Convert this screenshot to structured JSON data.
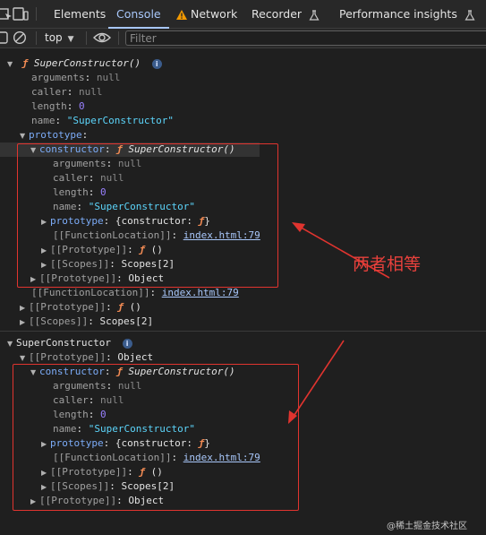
{
  "tabs": [
    {
      "label": "Elements"
    },
    {
      "label": "Console"
    },
    {
      "label": "Network"
    },
    {
      "label": "Recorder"
    },
    {
      "label": "Performance insights"
    }
  ],
  "toolbar": {
    "context": "top",
    "filter_placeholder": "Filter"
  },
  "obj1": {
    "head_fn": "ƒ",
    "head_name": "SuperConstructor()",
    "info": "i",
    "arguments": {
      "key": "arguments",
      "val": "null"
    },
    "caller": {
      "key": "caller",
      "val": "null"
    },
    "length": {
      "key": "length",
      "val": "0"
    },
    "name": {
      "key": "name",
      "val": "\"SuperConstructor\""
    },
    "prototype": {
      "key": "prototype"
    },
    "constructor": {
      "key": "constructor",
      "fn": "ƒ",
      "name": "SuperConstructor()"
    },
    "c_arguments": {
      "key": "arguments",
      "val": "null"
    },
    "c_caller": {
      "key": "caller",
      "val": "null"
    },
    "c_length": {
      "key": "length",
      "val": "0"
    },
    "c_name": {
      "key": "name",
      "val": "\"SuperConstructor\""
    },
    "c_prototype": {
      "key": "prototype",
      "val": "{constructor: ",
      "fn": "ƒ",
      "close": "}"
    },
    "c_funcloc": {
      "key": "[[FunctionLocation]]",
      "val": "index.html:79"
    },
    "c_proto": {
      "key": "[[Prototype]]",
      "fn": "ƒ",
      "val": "()"
    },
    "c_scopes": {
      "key": "[[Scopes]]",
      "val": "Scopes[2]"
    },
    "p_proto": {
      "key": "[[Prototype]]",
      "val": "Object"
    },
    "funcloc": {
      "key": "[[FunctionLocation]]",
      "val": "index.html:79"
    },
    "proto": {
      "key": "[[Prototype]]",
      "fn": "ƒ",
      "val": "()"
    },
    "scopes": {
      "key": "[[Scopes]]",
      "val": "Scopes[2]"
    }
  },
  "obj2": {
    "head": "SuperConstructor",
    "info": "i",
    "proto": {
      "key": "[[Prototype]]",
      "val": "Object"
    },
    "constructor": {
      "key": "constructor",
      "fn": "ƒ",
      "name": "SuperConstructor()"
    },
    "c_arguments": {
      "key": "arguments",
      "val": "null"
    },
    "c_caller": {
      "key": "caller",
      "val": "null"
    },
    "c_length": {
      "key": "length",
      "val": "0"
    },
    "c_name": {
      "key": "name",
      "val": "\"SuperConstructor\""
    },
    "c_prototype": {
      "key": "prototype",
      "val": "{constructor: ",
      "fn": "ƒ",
      "close": "}"
    },
    "c_funcloc": {
      "key": "[[FunctionLocation]]",
      "val": "index.html:79"
    },
    "c_proto": {
      "key": "[[Prototype]]",
      "fn": "ƒ",
      "val": "()"
    },
    "c_scopes": {
      "key": "[[Scopes]]",
      "val": "Scopes[2]"
    },
    "p_proto": {
      "key": "[[Prototype]]",
      "val": "Object"
    }
  },
  "annotation": {
    "text": "两者相等"
  },
  "watermark": {
    "text": "@稀土掘金技术社区"
  },
  "colors": {
    "accent": "#a8c7fa",
    "annotation": "#e0342f",
    "function": "#f28b54"
  }
}
